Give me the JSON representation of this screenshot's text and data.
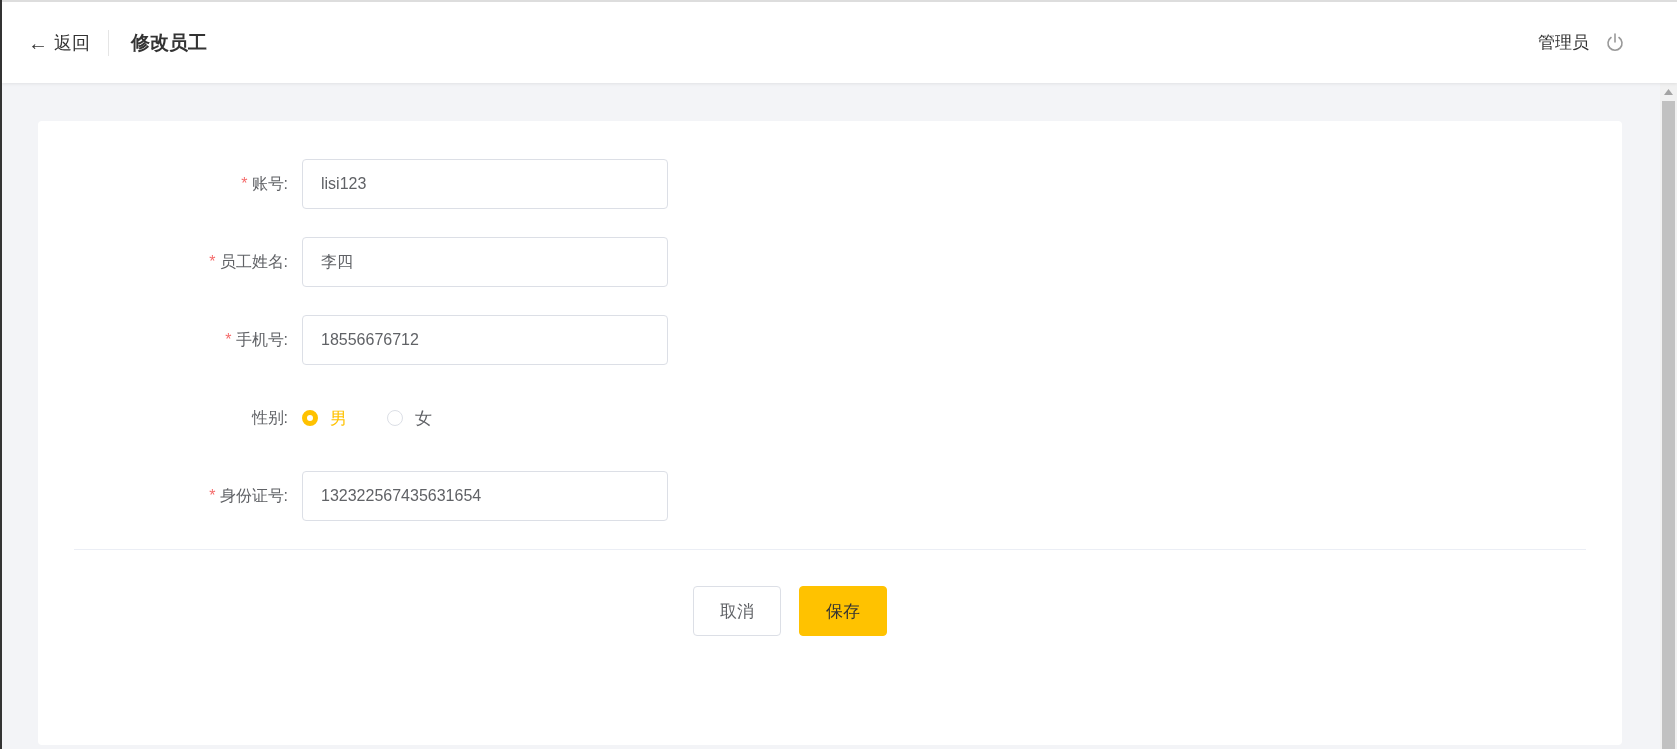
{
  "header": {
    "back": {
      "icon": "←",
      "label": "返回"
    },
    "title": "修改员工",
    "user": "管理员"
  },
  "form": {
    "fields": [
      {
        "kind": "text",
        "required_mark": "*",
        "label": "账号:",
        "value": "lisi123"
      },
      {
        "kind": "text",
        "required_mark": "*",
        "label": "员工姓名:",
        "value": "李四"
      },
      {
        "kind": "text",
        "required_mark": "*",
        "label": "手机号:",
        "value": "18556676712"
      },
      {
        "kind": "radio",
        "label": "性别:",
        "options": [
          {
            "label": "男",
            "selected": true
          },
          {
            "label": "女",
            "selected": false
          }
        ]
      },
      {
        "kind": "text",
        "required_mark": "*",
        "label": "身份证号:",
        "value": "132322567435631654"
      }
    ]
  },
  "buttons": [
    {
      "kind": "secondary",
      "label": "取消"
    },
    {
      "kind": "primary",
      "label": "保存"
    }
  ]
}
